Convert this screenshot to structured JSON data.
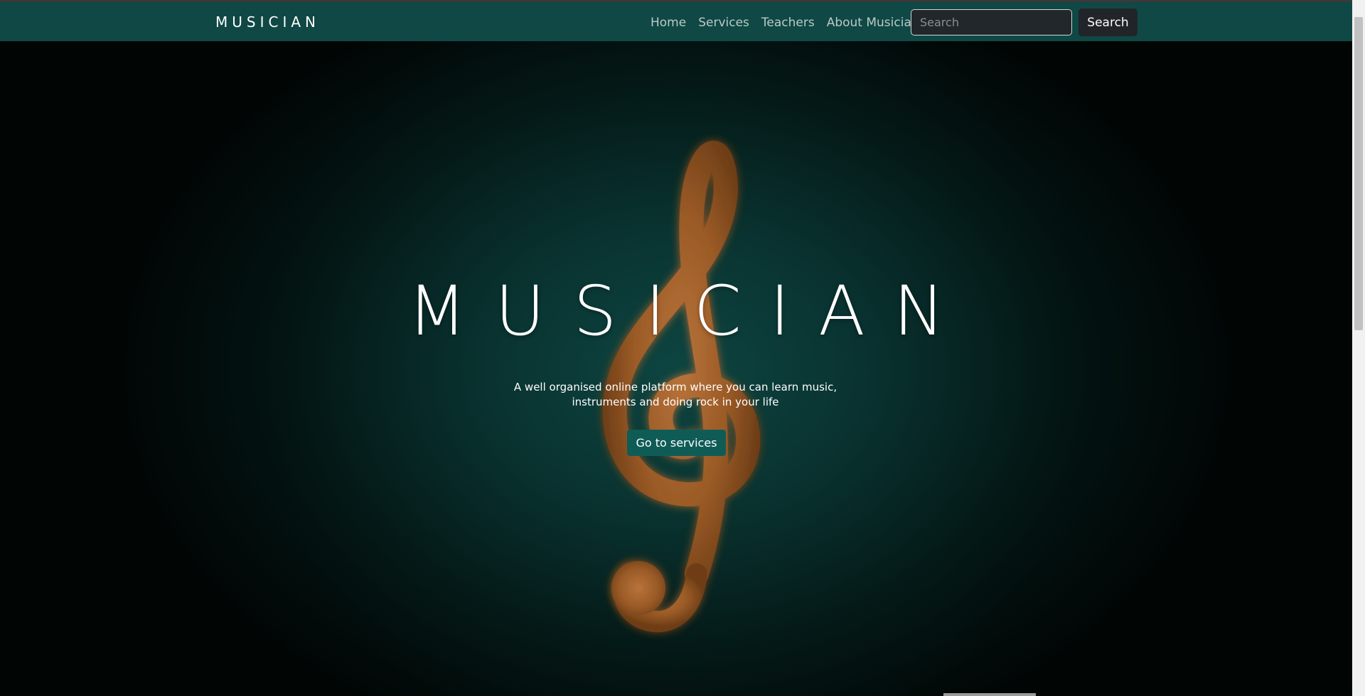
{
  "navbar": {
    "brand": "MUSICIAN",
    "links": [
      {
        "label": "Home"
      },
      {
        "label": "Services"
      },
      {
        "label": "Teachers"
      },
      {
        "label": "About Musician"
      }
    ],
    "search": {
      "placeholder": "Search",
      "value": "",
      "button_label": "Search"
    }
  },
  "hero": {
    "title": "MUSICIAN",
    "subtitle": "A well organised online platform where you can learn music, instruments and doing rock in your life",
    "cta_label": "Go to services",
    "background_image": "treble-clef-icon"
  },
  "colors": {
    "navbar": "#0f4845",
    "hero_bg": "#072b29",
    "cta": "#0f5c57",
    "search_button": "#212529",
    "clef": "#a8652c"
  }
}
